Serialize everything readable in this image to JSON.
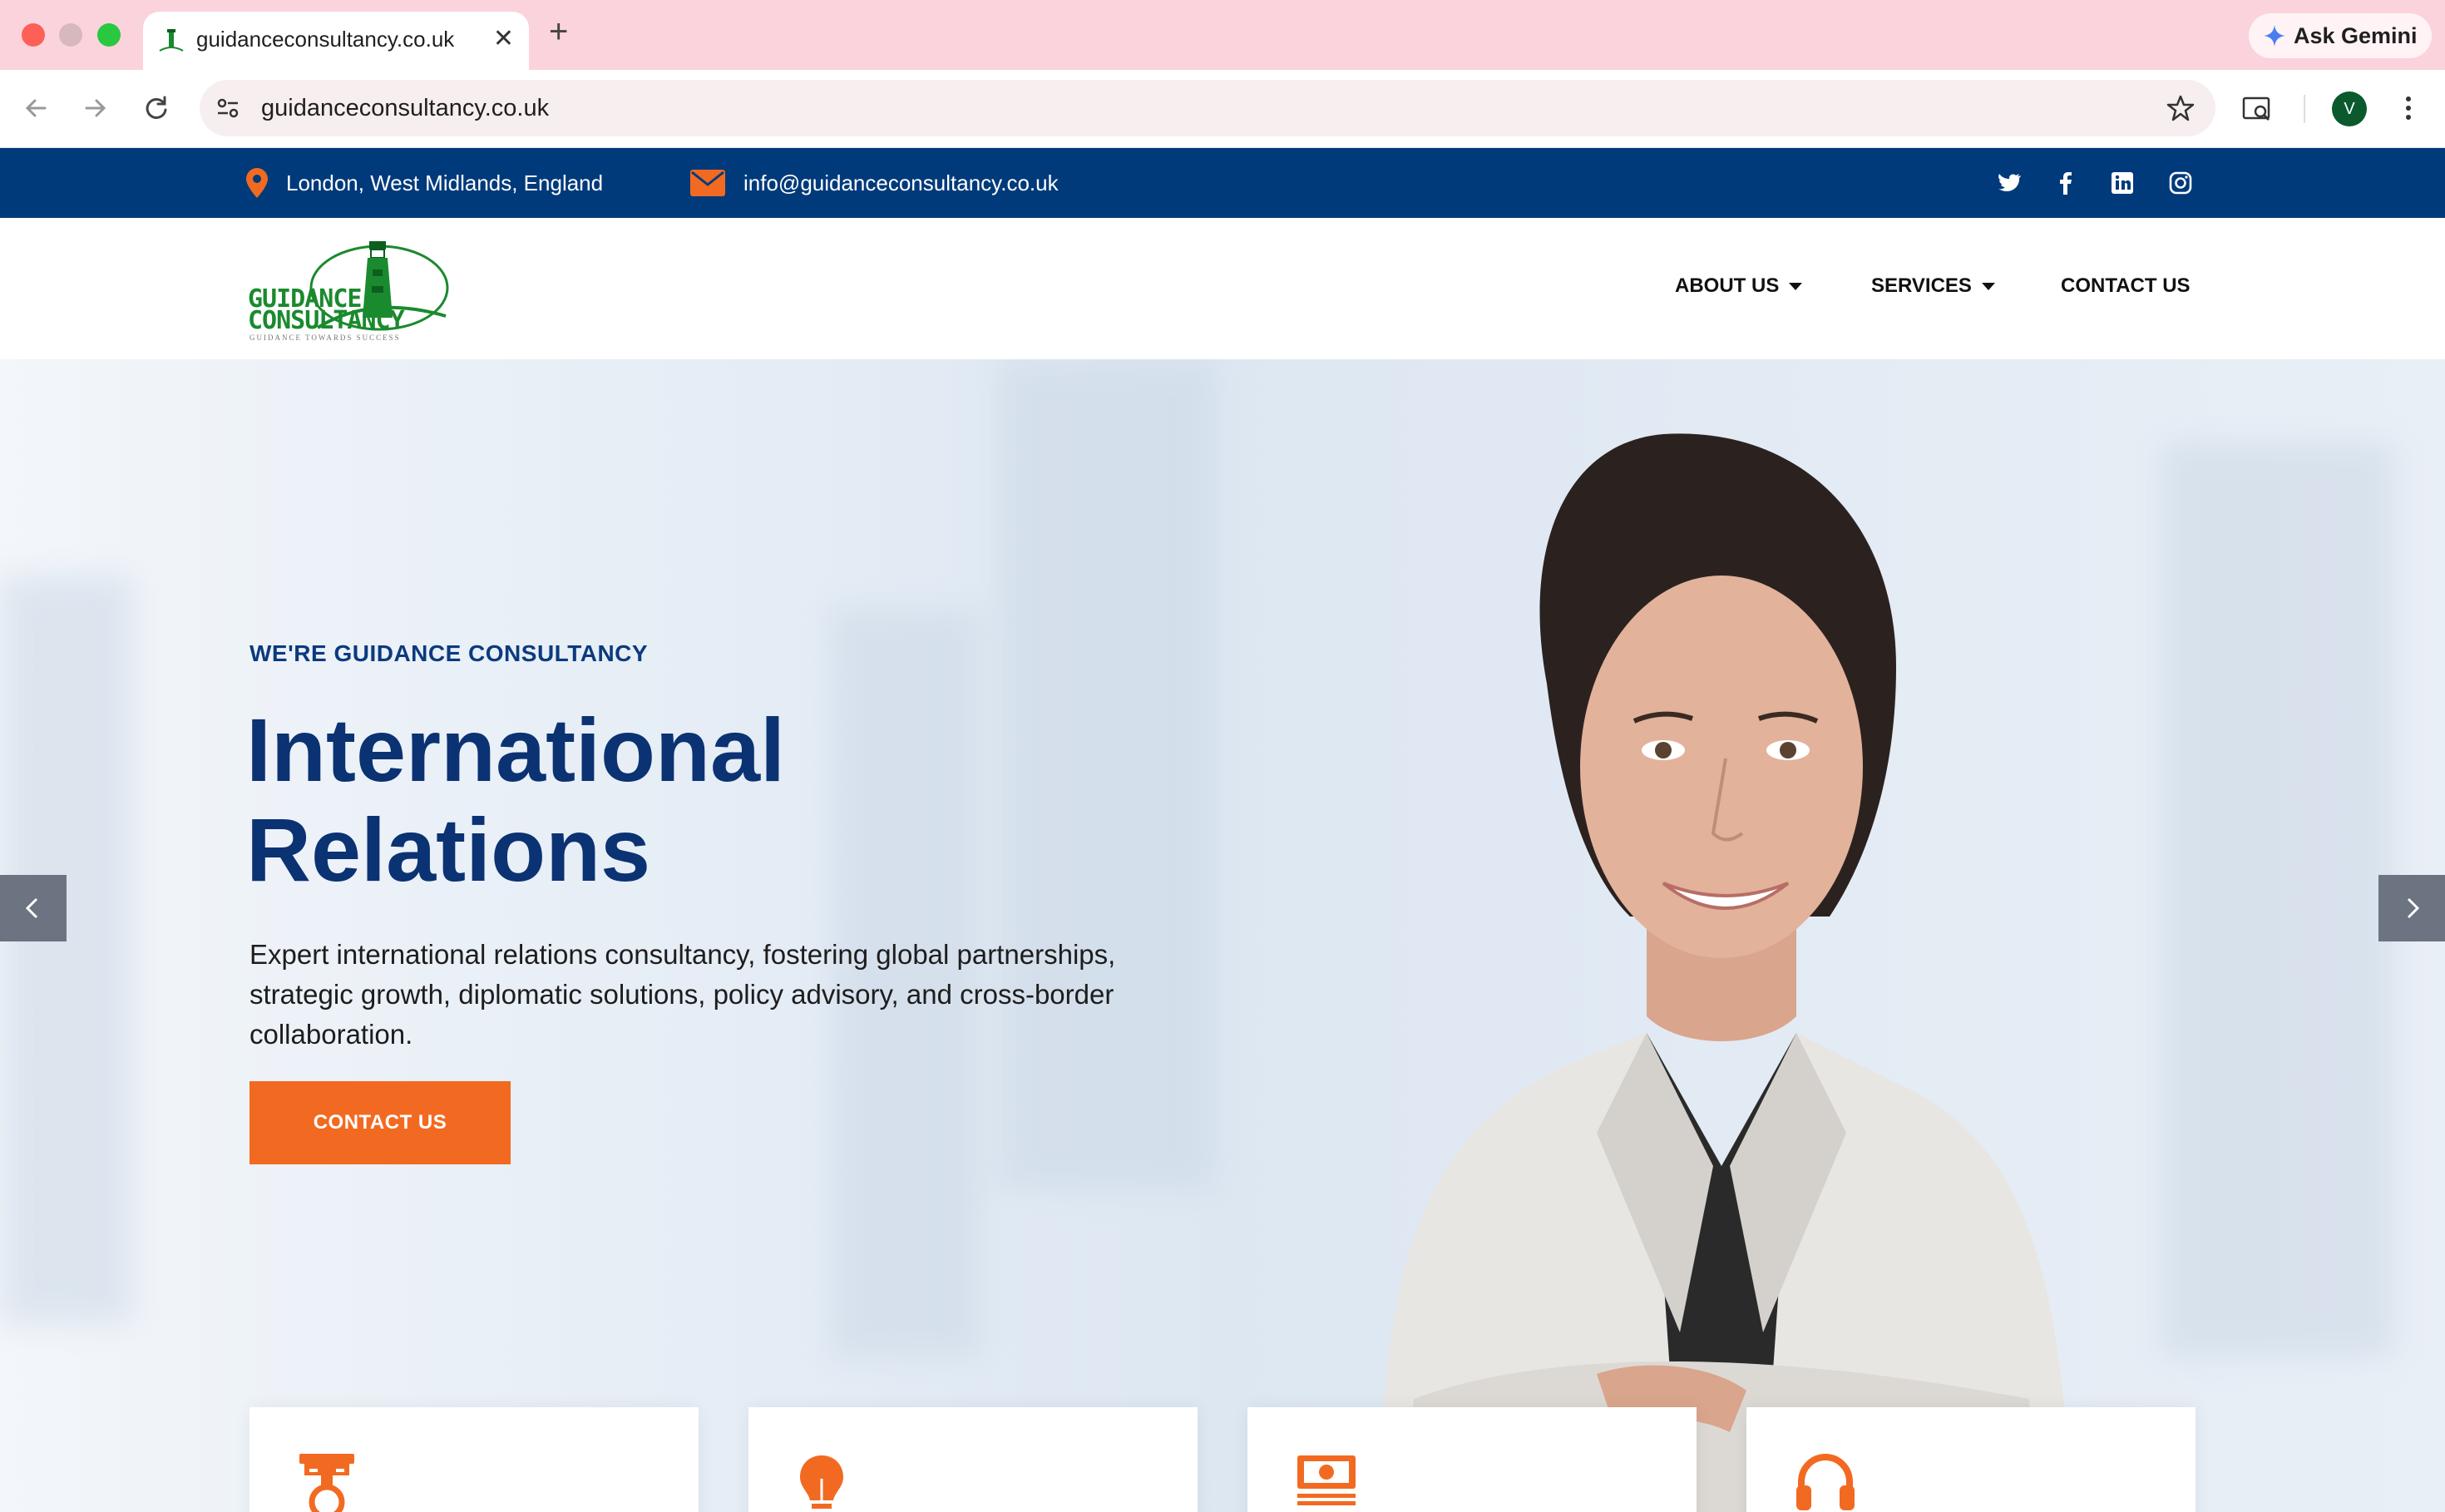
{
  "browser": {
    "tab_title": "guidanceconsultancy.co.uk",
    "url": "guidanceconsultancy.co.uk",
    "gemini_label": "Ask Gemini",
    "avatar_letter": "V",
    "accent": "#fbd3dc"
  },
  "topbar": {
    "location": "London, West Midlands, England",
    "email": "info@guidanceconsultancy.co.uk",
    "social_icons": [
      "twitter-icon",
      "facebook-icon",
      "linkedin-icon",
      "instagram-icon"
    ],
    "background": "#003a7a"
  },
  "header": {
    "logo_line1": "GUIDANCE",
    "logo_line2": "CONSULTANCY",
    "logo_tagline": "GUIDANCE TOWARDS SUCCESS",
    "nav": {
      "about": "ABOUT US",
      "services": "SERVICES",
      "contact": "CONTACT US"
    }
  },
  "hero": {
    "eyebrow": "WE'RE GUIDANCE CONSULTANCY",
    "title_line1": "International",
    "title_line2": "Relations",
    "description": "Expert international relations consultancy, fostering global partnerships, strategic growth, diplomatic solutions, policy advisory, and cross-border collaboration.",
    "cta": "CONTACT US",
    "accent": "#f26a21",
    "title_color": "#0b3272"
  },
  "feature_cards": {
    "icons": [
      "medal-icon",
      "lightbulb-icon",
      "money-icon",
      "headset-icon"
    ]
  }
}
